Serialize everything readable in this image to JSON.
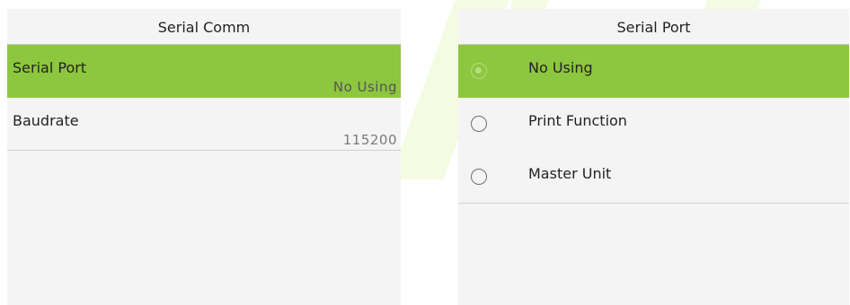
{
  "left_screen": {
    "title": "Serial Comm",
    "items": [
      {
        "label": "Serial Port",
        "value": "No Using",
        "selected": true
      },
      {
        "label": "Baudrate",
        "value": "115200",
        "selected": false
      }
    ]
  },
  "right_screen": {
    "title": "Serial Port",
    "options": [
      {
        "label": "No Using",
        "checked": true
      },
      {
        "label": "Print Function",
        "checked": false
      },
      {
        "label": "Master Unit",
        "checked": false
      }
    ]
  },
  "colors": {
    "selected_row": "#8dc63f",
    "screen_background": "#f4f4f4"
  }
}
